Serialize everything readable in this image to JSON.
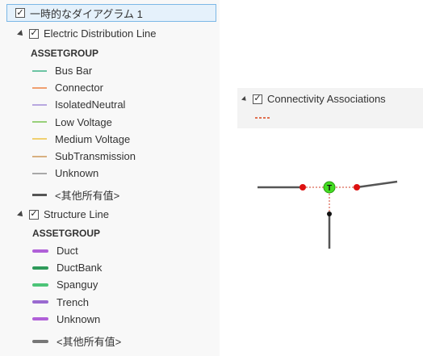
{
  "toc": {
    "map": {
      "label": "一時的なダイアグラム 1",
      "checked": true
    },
    "layers": [
      {
        "label": "Electric Distribution Line",
        "checked": true,
        "group_heading": "ASSETGROUP",
        "items": [
          {
            "label": "Bus Bar",
            "color": "#6cc4a4"
          },
          {
            "label": "Connector",
            "color": "#f0a070"
          },
          {
            "label": "IsolatedNeutral",
            "color": "#b8a8e0"
          },
          {
            "label": "Low Voltage",
            "color": "#98d07a"
          },
          {
            "label": "Medium Voltage",
            "color": "#f0d070"
          },
          {
            "label": "SubTransmission",
            "color": "#d8b080"
          },
          {
            "label": "Unknown",
            "color": "#a8a8a8"
          },
          {
            "label": "<其他所有值>",
            "color": "#555555"
          }
        ]
      },
      {
        "label": "Structure Line",
        "checked": true,
        "group_heading": "ASSETGROUP",
        "items": [
          {
            "label": "Duct",
            "color": "#b060d8"
          },
          {
            "label": "DuctBank",
            "color": "#2e9a5a"
          },
          {
            "label": "Spanguy",
            "color": "#4cc478"
          },
          {
            "label": "Trench",
            "color": "#9a6ad0"
          },
          {
            "label": "Unknown",
            "color": "#b060d8"
          },
          {
            "label": "<其他所有值>",
            "color": "#777777"
          }
        ]
      }
    ]
  },
  "connectivity": {
    "label": "Connectivity Associations",
    "checked": true,
    "color": "#e07050"
  },
  "diagram": {
    "junction_label": "T",
    "line_color": "#555555",
    "node_color": "#dd1111",
    "junction_color": "#44dd22",
    "assoc_color": "#e08070"
  }
}
